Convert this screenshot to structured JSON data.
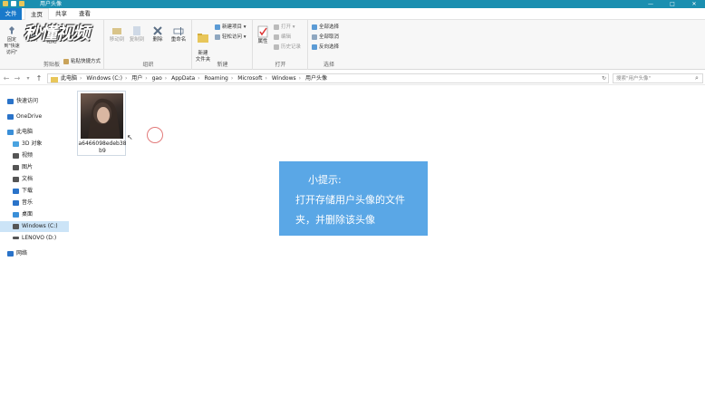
{
  "window": {
    "title": "用户头像",
    "controls": [
      "—",
      "□",
      "✕"
    ]
  },
  "ribbon_tabs": [
    "文件",
    "主页",
    "共享",
    "查看"
  ],
  "ribbon": {
    "clipboard": {
      "pin": "固定到\"快速访问\"",
      "copy": "复制",
      "paste": "粘贴",
      "paste_shortcut": "粘贴快捷方式",
      "label": "剪贴板"
    },
    "organize": {
      "move_to": "移动到",
      "copy_to": "复制到",
      "delete": "删除",
      "rename": "重命名",
      "label": "组织"
    },
    "new": {
      "new_folder": "新建\n文件夹",
      "new_item": "新建项目 ▾",
      "easy_access": "轻松访问 ▾",
      "label": "新建"
    },
    "open": {
      "properties": "属性",
      "open": "打开 ▾",
      "edit": "编辑",
      "history": "历史记录",
      "label": "打开"
    },
    "select": {
      "select_all": "全部选择",
      "select_none": "全部取消",
      "invert": "反向选择",
      "label": "选择"
    }
  },
  "watermark": "秒懂视频",
  "address": {
    "back": "←",
    "forward": "→",
    "recent": "▾",
    "up": "↑",
    "crumbs": [
      "此电脑",
      "Windows (C:)",
      "用户",
      "gao",
      "AppData",
      "Roaming",
      "Microsoft",
      "Windows",
      "用户头像"
    ],
    "search_placeholder": "搜索\"用户头像\""
  },
  "sidebar": {
    "items": [
      {
        "label": "快速访问",
        "icon": "star-icon",
        "color": "#2a73c9"
      },
      {
        "label": "OneDrive",
        "icon": "cloud-icon",
        "color": "#2a73c9"
      },
      {
        "label": "此电脑",
        "icon": "computer-icon",
        "color": "#3a8fd8"
      },
      {
        "label": "3D 对象",
        "icon": "cube-icon",
        "color": "#4aa3e0"
      },
      {
        "label": "视频",
        "icon": "video-icon",
        "color": "#555"
      },
      {
        "label": "图片",
        "icon": "picture-icon",
        "color": "#555"
      },
      {
        "label": "文档",
        "icon": "document-icon",
        "color": "#555"
      },
      {
        "label": "下载",
        "icon": "download-icon",
        "color": "#2a73c9"
      },
      {
        "label": "音乐",
        "icon": "music-icon",
        "color": "#2a73c9"
      },
      {
        "label": "桌面",
        "icon": "desktop-icon",
        "color": "#3a8fd8"
      },
      {
        "label": "Windows (C:)",
        "icon": "drive-icon",
        "color": "#555"
      },
      {
        "label": "LENOVO (D:)",
        "icon": "drive-icon",
        "color": "#555"
      },
      {
        "label": "网络",
        "icon": "network-icon",
        "color": "#2a73c9"
      }
    ]
  },
  "file": {
    "name": "a6466098edeb38b9"
  },
  "tip": {
    "title": "小提示:",
    "body": "打开存储用户头像的文件夹，并删除该头像"
  }
}
